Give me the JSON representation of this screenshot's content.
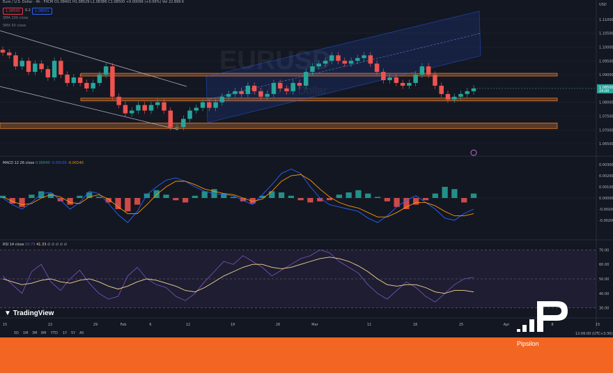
{
  "header": {
    "symbol_line": "Euro / U.S. Dollar · 4h · FXCM",
    "ohlc": "O1.08401 H1.08529 L1.08386 C1.08500 +0.00099 (+0.09%)",
    "vol": "Vol 22.899 K",
    "bid": "1.08500",
    "spread": "0.2",
    "ask": "1.08501"
  },
  "watermark": {
    "symbol": "EURUSD",
    "interval": "4h",
    "name": "Euro / U.S. Dollar"
  },
  "indicators": {
    "sma200": "SMA 200 close",
    "sma50": "SMA 50 close",
    "macd": "MACD 12 26 close",
    "macd_values": [
      "0.00040",
      "-0.00100",
      "-0.00140"
    ],
    "rsi": "RSI 14 close",
    "rsi_values": [
      "50.73",
      "41.33",
      "∅",
      "∅",
      "∅",
      "∅",
      "∅"
    ]
  },
  "axes": {
    "currency": "USD",
    "price_ticks": [
      "1.11000",
      "1.10500",
      "1.10000",
      "1.09500",
      "1.09000",
      "1.08500",
      "1.08000",
      "1.07500",
      "1.07000",
      "1.06500"
    ],
    "last_price": "1.08500",
    "last_price_time": "24:00",
    "macd_ticks": [
      "0.00300",
      "0.00200",
      "0.00100",
      "0.00000",
      "-0.00100",
      "-0.00200"
    ],
    "rsi_ticks": [
      "70.00",
      "60.00",
      "50.00",
      "40.00",
      "30.00"
    ],
    "time_ticks": [
      "15",
      "22",
      "29",
      "Feb",
      "6",
      "12",
      "19",
      "26",
      "Mar",
      "11",
      "18",
      "25",
      "Apr",
      "8",
      "15"
    ]
  },
  "ranges": [
    "5D",
    "1M",
    "3M",
    "6M",
    "YTD",
    "1Y",
    "5Y",
    "All"
  ],
  "clock": "12:06:00 (UTC+3:30)",
  "branding": {
    "tradingview": "TradingView",
    "pipsilon": "Pipsilon"
  },
  "colors": {
    "background": "#131722",
    "up": "#26a69a",
    "down": "#ef5350",
    "zone": "#e07b2f",
    "channel": "#2962ff",
    "macd_line": "#2962ff",
    "signal_line": "#ff9800",
    "rsi_line": "#7e57c2",
    "rsi_ma": "#f6d88d",
    "footer": "#f26522"
  },
  "chart_data": {
    "type": "candlestick",
    "symbol": "EURUSD",
    "timeframe": "4h",
    "price_range": [
      1.062,
      1.114
    ],
    "close_path": [
      1.098,
      1.097,
      1.093,
      1.095,
      1.091,
      1.094,
      1.092,
      1.089,
      1.095,
      1.09,
      1.087,
      1.089,
      1.087,
      1.085,
      1.087,
      1.09,
      1.093,
      1.082,
      1.079,
      1.076,
      1.077,
      1.079,
      1.077,
      1.079,
      1.08,
      1.077,
      1.071,
      1.071,
      1.074,
      1.077,
      1.078,
      1.08,
      1.078,
      1.08,
      1.082,
      1.083,
      1.084,
      1.083,
      1.086,
      1.084,
      1.082,
      1.083,
      1.087,
      1.085,
      1.084,
      1.087,
      1.086,
      1.091,
      1.093,
      1.094,
      1.095,
      1.097,
      1.095,
      1.094,
      1.095,
      1.096,
      1.097,
      1.094,
      1.091,
      1.088,
      1.089,
      1.087,
      1.086,
      1.087,
      1.09,
      1.093,
      1.09,
      1.086,
      1.083,
      1.081,
      1.082,
      1.083,
      1.084,
      1.085
    ],
    "zones": [
      {
        "from": 1.0895,
        "to": 1.0905
      },
      {
        "from": 1.0805,
        "to": 1.0815
      },
      {
        "from": 1.0705,
        "to": 1.0725
      }
    ],
    "macd": {
      "ylim": [
        -0.0035,
        0.0035
      ],
      "hist": [
        0.0002,
        -0.0005,
        -0.0008,
        0.0003,
        0.0006,
        0.0004,
        -0.0003,
        -0.0006,
        0.0002,
        0.0005,
        0.0001,
        -0.0004,
        -0.001,
        -0.0012,
        -0.0006,
        0.0004,
        0.0007,
        0.0003,
        -0.0002,
        -0.0004,
        0.0002,
        0.0006,
        0.0008,
        0.0004,
        0.0001,
        -0.0003,
        -0.0005,
        0.0002,
        0.0006,
        0.0005,
        0.0002,
        -0.0002,
        -0.0004,
        -0.0003,
        -0.0002,
        0.0003,
        0.0005,
        0.0007,
        0.0004,
        0.0001,
        -0.0003,
        -0.0008,
        -0.001,
        -0.0006,
        -0.0002,
        0.0004,
        0.001,
        0.0008,
        -0.0004,
        0.0004
      ],
      "macd_line": [
        0.0,
        -0.0006,
        -0.001,
        -0.0004,
        0.0004,
        0.0005,
        -0.0002,
        -0.001,
        -0.0004,
        0.0006,
        0.0004,
        -0.0005,
        -0.0015,
        -0.0022,
        -0.0012,
        0.0003,
        0.001,
        0.0016,
        0.0018,
        0.0015,
        0.001,
        0.0006,
        0.0004,
        0.0003,
        0.0002,
        -0.0002,
        -0.0006,
        0.0003,
        0.0012,
        0.0022,
        0.0026,
        0.0022,
        0.001,
        0.0,
        -0.0006,
        -0.0008,
        -0.001,
        -0.0012,
        -0.0018,
        -0.0022,
        -0.0016,
        -0.0008,
        -0.0002,
        0.0002,
        -0.0004,
        -0.001,
        -0.0018,
        -0.002,
        -0.0014,
        -0.001
      ],
      "signal_line": [
        0.0001,
        -0.0003,
        -0.0006,
        -0.0005,
        0.0,
        0.0003,
        0.0001,
        -0.0004,
        -0.0005,
        0.0001,
        0.0003,
        -0.0001,
        -0.0008,
        -0.0014,
        -0.0014,
        -0.0006,
        0.0003,
        0.001,
        0.0015,
        0.0015,
        0.0012,
        0.0008,
        0.0006,
        0.0004,
        0.0003,
        0.0,
        -0.0003,
        -0.0001,
        0.0006,
        0.0015,
        0.002,
        0.0021,
        0.0016,
        0.0008,
        0.0001,
        -0.0004,
        -0.0007,
        -0.0009,
        -0.0013,
        -0.0017,
        -0.0017,
        -0.0013,
        -0.0008,
        -0.0004,
        -0.0004,
        -0.0007,
        -0.0012,
        -0.0016,
        -0.0016,
        -0.0014
      ]
    },
    "rsi": {
      "ylim": [
        25,
        75
      ],
      "band": [
        30,
        70
      ],
      "rsi_line": [
        52,
        46,
        40,
        55,
        60,
        48,
        42,
        50,
        56,
        47,
        40,
        36,
        38,
        52,
        58,
        50,
        46,
        44,
        38,
        35,
        40,
        48,
        55,
        62,
        60,
        66,
        62,
        58,
        52,
        56,
        60,
        64,
        66,
        70,
        68,
        62,
        58,
        54,
        46,
        40,
        36,
        42,
        48,
        44,
        38,
        34,
        40,
        46,
        50,
        51
      ],
      "ma_line": [
        50,
        48,
        46,
        47,
        49,
        50,
        48,
        47,
        49,
        50,
        48,
        45,
        43,
        45,
        48,
        50,
        49,
        47,
        45,
        42,
        41,
        44,
        48,
        52,
        55,
        58,
        60,
        60,
        58,
        57,
        58,
        60,
        62,
        64,
        65,
        64,
        62,
        59,
        55,
        50,
        46,
        45,
        46,
        46,
        44,
        41,
        40,
        42,
        42,
        41
      ]
    }
  }
}
